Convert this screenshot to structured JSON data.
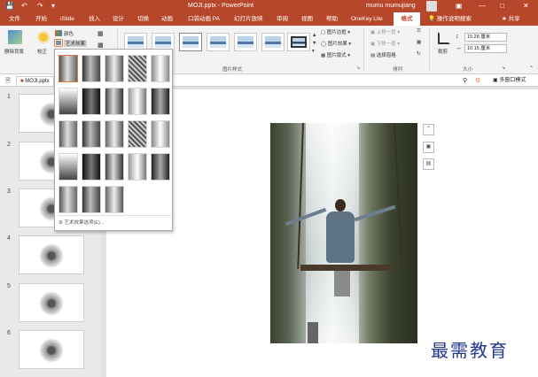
{
  "titlebar": {
    "title": "MOJI.pptx - PowerPoint",
    "user": "mumu mumujiang"
  },
  "ribbon_tabs": [
    "文件",
    "开始",
    "iSlide",
    "插入",
    "设计",
    "切换",
    "动画",
    "口袋动画 PA",
    "幻灯片放映",
    "审阅",
    "视图",
    "帮助",
    "OneKey Lite",
    "格式"
  ],
  "active_tab": "格式",
  "tell_me": "操作说明搜索",
  "share": "共享",
  "ribbon": {
    "remove_bg": "删除背景",
    "corrections": "校正",
    "color": "颜色",
    "artistic_effects": "艺术效果",
    "group_picture_styles": "图片样式",
    "border": "图片边框",
    "effects": "图片效果",
    "layout": "图片版式",
    "bring_forward": "上移一层",
    "send_backward": "下移一层",
    "selection_pane": "选择窗格",
    "group_arrange": "排列",
    "crop": "裁剪",
    "height": "15.28 厘米",
    "width": "10.15 厘米",
    "group_size": "大小"
  },
  "document_tab": "MOJI.pptx",
  "multi_window": "多窗口模式",
  "slides": [
    "1",
    "2",
    "3",
    "4",
    "5",
    "6"
  ],
  "dropdown": {
    "footer": "艺术效果选项(E)..."
  },
  "watermark": "最需教育",
  "colors": {
    "accent": "#b7472a",
    "watermark": "#1f3a8a",
    "selected_effect": "#e07a3a"
  }
}
